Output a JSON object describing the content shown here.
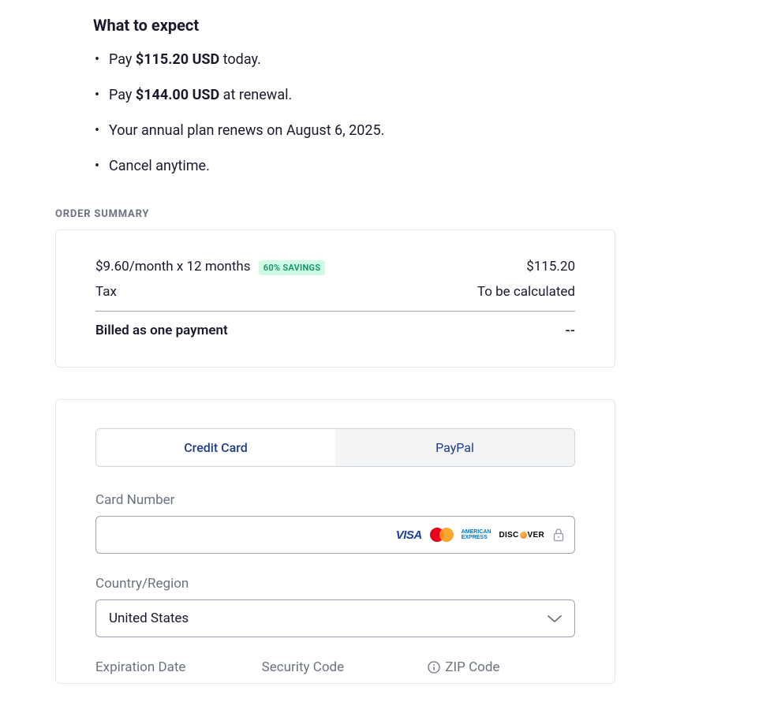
{
  "expect": {
    "title": "What to expect",
    "items": [
      {
        "prefix": "Pay ",
        "bold": "$115.20 USD",
        "suffix": " today."
      },
      {
        "prefix": "Pay ",
        "bold": "$144.00 USD",
        "suffix": " at renewal."
      },
      {
        "prefix": "Your annual plan renews on August 6, 2025.",
        "bold": "",
        "suffix": ""
      },
      {
        "prefix": "Cancel anytime.",
        "bold": "",
        "suffix": ""
      }
    ]
  },
  "orderSummary": {
    "label": "ORDER SUMMARY",
    "lineItem": "$9.60/month x 12 months",
    "savingsBadge": "60% SAVINGS",
    "lineItemPrice": "$115.20",
    "taxLabel": "Tax",
    "taxValue": "To be calculated",
    "totalLabel": "Billed as one payment",
    "totalValue": "--"
  },
  "payment": {
    "tabs": {
      "creditCard": "Credit Card",
      "paypal": "PayPal"
    },
    "cardNumber": {
      "label": "Card Number",
      "value": ""
    },
    "cardBrands": {
      "visa": "VISA",
      "amex1": "AMERICAN",
      "amex2": "EXPRESS",
      "discoverPre": "DISC",
      "discoverPost": "VER"
    },
    "country": {
      "label": "Country/Region",
      "value": "United States"
    },
    "expiration": {
      "label": "Expiration Date"
    },
    "securityCode": {
      "label": "Security Code"
    },
    "zip": {
      "label": "ZIP Code"
    }
  }
}
